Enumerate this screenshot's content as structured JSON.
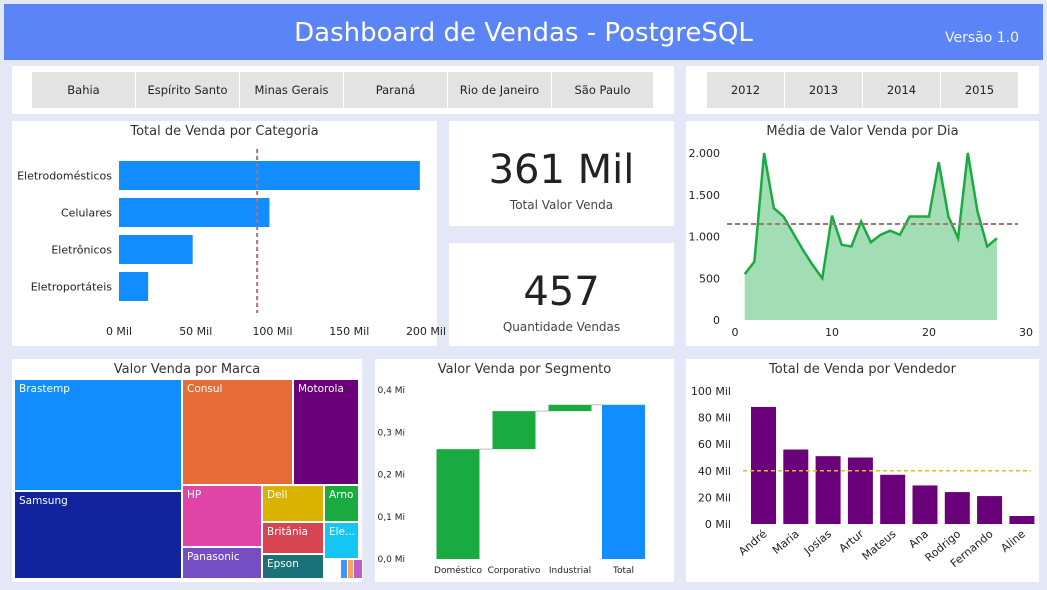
{
  "header": {
    "title": "Dashboard de Vendas - PostgreSQL",
    "version": "Versão 1.0"
  },
  "state_slicer": [
    "Bahia",
    "Espírito Santo",
    "Minas Gerais",
    "Paraná",
    "Rio de Janeiro",
    "São Paulo"
  ],
  "year_slicer": [
    "2012",
    "2013",
    "2014",
    "2015"
  ],
  "kpi": {
    "total_value": "361 Mil",
    "total_value_label": "Total Valor Venda",
    "quantity": "457",
    "quantity_label": "Quantidade Vendas"
  },
  "colors": {
    "header": "#5b84f6",
    "bar_blue": "#118dff",
    "line_green": "#1aab40",
    "area_green": "#a3ddb3",
    "purple": "#6b007b",
    "avg_dashed": "#a8747a",
    "avg_gold": "#e8b62a"
  },
  "chart_data": [
    {
      "id": "categoria",
      "type": "bar",
      "orientation": "horizontal",
      "title": "Total de Venda por Categoria",
      "categories": [
        "Eletrodomésticos",
        "Celulares",
        "Eletrônicos",
        "Eletroportáteis"
      ],
      "values": [
        196,
        98,
        48,
        19
      ],
      "value_unit": "Mil",
      "xlim": [
        0,
        200
      ],
      "ticks": [
        "0 Mil",
        "50 Mil",
        "100 Mil",
        "150 Mil",
        "200 Mil"
      ],
      "average_line": 90
    },
    {
      "id": "dia",
      "type": "area",
      "title": "Média de Valor Venda por Dia",
      "x": [
        1,
        2,
        3,
        4,
        5,
        6,
        7,
        8,
        9,
        10,
        11,
        12,
        13,
        14,
        15,
        16,
        17,
        18,
        19,
        20,
        21,
        22,
        23,
        24,
        25,
        26,
        27
      ],
      "y": [
        550,
        700,
        2000,
        1340,
        1240,
        1040,
        840,
        660,
        500,
        1250,
        900,
        880,
        1180,
        930,
        1020,
        1070,
        1020,
        1240,
        1240,
        1240,
        1890,
        1240,
        980,
        2000,
        1300,
        880,
        980
      ],
      "xlim": [
        0,
        30
      ],
      "ylim": [
        0,
        2000
      ],
      "x_ticks": [
        "0",
        "10",
        "20",
        "30"
      ],
      "y_ticks": [
        "0",
        "500",
        "1.000",
        "1.500",
        "2.000"
      ],
      "average_line": 1150
    },
    {
      "id": "marca",
      "type": "treemap",
      "title": "Valor Venda por Marca",
      "items": [
        {
          "name": "Brastemp",
          "color": "#118dff"
        },
        {
          "name": "Samsung",
          "color": "#12239e"
        },
        {
          "name": "Consul",
          "color": "#e66c37"
        },
        {
          "name": "Motorola",
          "color": "#6b007b"
        },
        {
          "name": "HP",
          "color": "#e044a7"
        },
        {
          "name": "Panasonic",
          "color": "#744ec2"
        },
        {
          "name": "Dell",
          "color": "#d9b300"
        },
        {
          "name": "Arno",
          "color": "#1aab40"
        },
        {
          "name": "Britânia",
          "color": "#d64550"
        },
        {
          "name": "Ele...",
          "color": "#15c6f4"
        },
        {
          "name": "Epson",
          "color": "#197278"
        },
        {
          "name": "",
          "color": "#4092ff"
        },
        {
          "name": "",
          "color": "#ffa058"
        },
        {
          "name": "",
          "color": "#be5dc9"
        }
      ]
    },
    {
      "id": "segmento",
      "type": "waterfall",
      "title": "Valor Venda por Segmento",
      "categories": [
        "Doméstico",
        "Corporativo",
        "Industrial",
        "Total"
      ],
      "values": [
        0.26,
        0.09,
        0.015,
        0.365
      ],
      "ylim": [
        0,
        0.4
      ],
      "y_ticks": [
        "0,0 Mi",
        "0,1 Mi",
        "0,2 Mi",
        "0,3 Mi",
        "0,4 Mi"
      ]
    },
    {
      "id": "vendedor",
      "type": "bar",
      "title": "Total de Venda por Vendedor",
      "categories": [
        "André",
        "Maria",
        "Josias",
        "Artur",
        "Mateus",
        "Ana",
        "Rodrigo",
        "Fernando",
        "Aline"
      ],
      "values": [
        88,
        56,
        51,
        50,
        37,
        29,
        24,
        21,
        6
      ],
      "value_unit": "Mil",
      "ylim": [
        0,
        100
      ],
      "y_ticks": [
        "0 Mil",
        "20 Mil",
        "40 Mil",
        "60 Mil",
        "80 Mil",
        "100 Mil"
      ],
      "average_line": 40
    }
  ]
}
